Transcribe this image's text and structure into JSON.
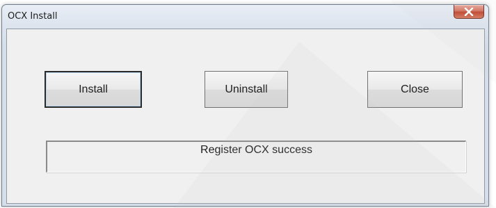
{
  "window": {
    "title": "OCX Install",
    "close_icon": "close-x-icon"
  },
  "buttons": {
    "install_label": "Install",
    "uninstall_label": "Uninstall",
    "close_label": "Close"
  },
  "status": {
    "text": "Register OCX success"
  },
  "colors": {
    "client_bg": "#f0f0f0",
    "close_button_red": "#c0452c"
  }
}
